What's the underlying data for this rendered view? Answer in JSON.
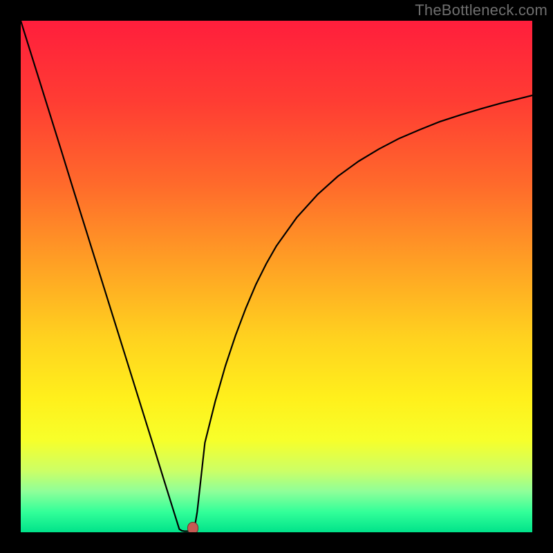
{
  "watermark": "TheBottleneck.com",
  "marker": {
    "x_frac": 0.336,
    "y_frac": 0.992
  },
  "gradient": {
    "stops": [
      {
        "pct": 0,
        "color": "#ff1e3c"
      },
      {
        "pct": 16,
        "color": "#ff3d33"
      },
      {
        "pct": 32,
        "color": "#ff6a2b"
      },
      {
        "pct": 48,
        "color": "#ffa224"
      },
      {
        "pct": 62,
        "color": "#ffd21f"
      },
      {
        "pct": 74,
        "color": "#fff01c"
      },
      {
        "pct": 82,
        "color": "#f7ff2a"
      },
      {
        "pct": 88,
        "color": "#ccff66"
      },
      {
        "pct": 92,
        "color": "#8fff99"
      },
      {
        "pct": 96,
        "color": "#33ff99"
      },
      {
        "pct": 100,
        "color": "#00e38a"
      }
    ]
  },
  "chart_data": {
    "type": "line",
    "title": "",
    "xlabel": "",
    "ylabel": "",
    "x": [
      0.0,
      0.02,
      0.04,
      0.06,
      0.08,
      0.1,
      0.12,
      0.14,
      0.16,
      0.18,
      0.2,
      0.22,
      0.24,
      0.26,
      0.28,
      0.3,
      0.305,
      0.31,
      0.315,
      0.32,
      0.325,
      0.33,
      0.335,
      0.34,
      0.345,
      0.35,
      0.355,
      0.36,
      0.38,
      0.4,
      0.42,
      0.44,
      0.46,
      0.48,
      0.5,
      0.54,
      0.58,
      0.62,
      0.66,
      0.7,
      0.74,
      0.78,
      0.82,
      0.86,
      0.9,
      0.94,
      0.98,
      1.0
    ],
    "y": [
      1.0,
      0.936,
      0.872,
      0.808,
      0.744,
      0.679,
      0.615,
      0.551,
      0.487,
      0.423,
      0.359,
      0.295,
      0.231,
      0.167,
      0.102,
      0.038,
      0.022,
      0.006,
      0.003,
      0.002,
      0.002,
      0.002,
      0.002,
      0.01,
      0.04,
      0.085,
      0.13,
      0.175,
      0.255,
      0.325,
      0.385,
      0.438,
      0.485,
      0.525,
      0.56,
      0.616,
      0.66,
      0.696,
      0.725,
      0.749,
      0.77,
      0.787,
      0.803,
      0.816,
      0.828,
      0.839,
      0.849,
      0.854
    ],
    "xlim": [
      0,
      1
    ],
    "ylim": [
      0,
      1
    ],
    "annotations": [
      "marker at (0.336, 0.992) in axis-fraction coords (plot-pixel space, top-left origin flipped)"
    ]
  }
}
